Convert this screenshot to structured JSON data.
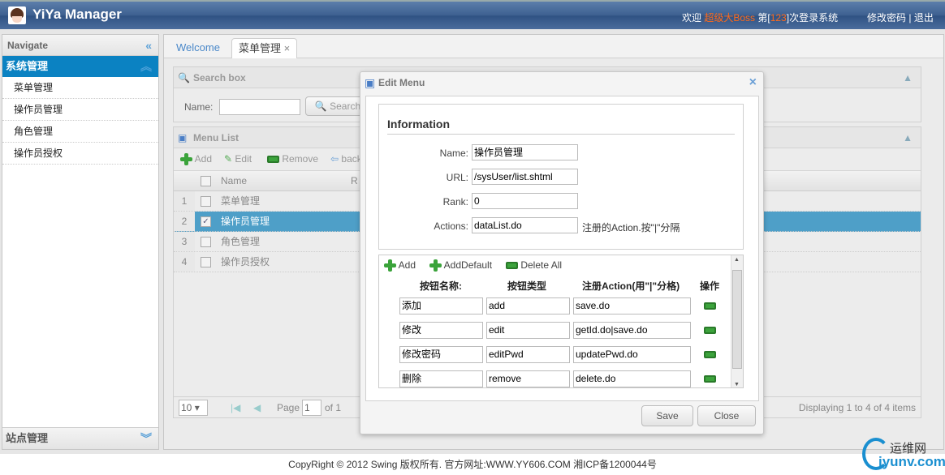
{
  "header": {
    "title": "YiYa Manager",
    "welcome_prefix": "欢迎 ",
    "user": "超级大Boss",
    "count_prefix": " 第[",
    "count": "123",
    "count_suffix": "]次登录系统",
    "change_password": "修改密码",
    "separator": "|",
    "logout": "退出"
  },
  "sidebar": {
    "title": "Navigate",
    "group": "系统管理",
    "items": [
      "菜单管理",
      "操作员管理",
      "角色管理",
      "操作员授权"
    ],
    "bottom_group": "站点管理"
  },
  "tabs": [
    {
      "label": "Welcome"
    },
    {
      "label": "菜单管理",
      "close": "×"
    }
  ],
  "search": {
    "title": "Search box",
    "name_label": "Name:",
    "name_value": "",
    "button": "Search"
  },
  "list": {
    "title": "Menu List",
    "toolbar": [
      "Add",
      "Edit",
      "Remove",
      "back"
    ],
    "columns": [
      "Name",
      "R"
    ],
    "rows": [
      {
        "n": "1",
        "name": "菜单管理",
        "checked": false
      },
      {
        "n": "2",
        "name": "操作员管理",
        "checked": true
      },
      {
        "n": "3",
        "name": "角色管理",
        "checked": false
      },
      {
        "n": "4",
        "name": "操作员授权",
        "checked": false
      }
    ],
    "pager": {
      "page_size": "10",
      "page_label": "Page",
      "page": "1",
      "of": "of 1",
      "display": "Displaying 1 to 4 of 4 items"
    }
  },
  "dialog": {
    "title": "Edit Menu",
    "close": "×",
    "section": "Information",
    "fields": [
      {
        "label": "Name:",
        "value": "操作员管理"
      },
      {
        "label": "URL:",
        "value": "/sysUser/list.shtml"
      },
      {
        "label": "Rank:",
        "value": "0"
      },
      {
        "label": "Actions:",
        "value": "dataList.do"
      }
    ],
    "actions_hint": "注册的Action.按\"|\"分隔",
    "sub_toolbar": [
      "Add",
      "AddDefault",
      "Delete All"
    ],
    "sub_columns": [
      "按钮名称:",
      "按钮类型",
      "注册Action(用\"|\"分格)",
      "操作"
    ],
    "sub_rows": [
      [
        "添加",
        "add",
        "save.do"
      ],
      [
        "修改",
        "edit",
        "getId.do|save.do"
      ],
      [
        "修改密码",
        "editPwd",
        "updatePwd.do"
      ],
      [
        "删除",
        "remove",
        "delete.do"
      ]
    ],
    "save": "Save",
    "cancel": "Close"
  },
  "footer": "CopyRight © 2012 Swing 版权所有.  官方网址:WWW.YY606.COM  湘ICP备1200044号",
  "watermark": {
    "top": "运维网",
    "bottom": "iyunv.com"
  }
}
